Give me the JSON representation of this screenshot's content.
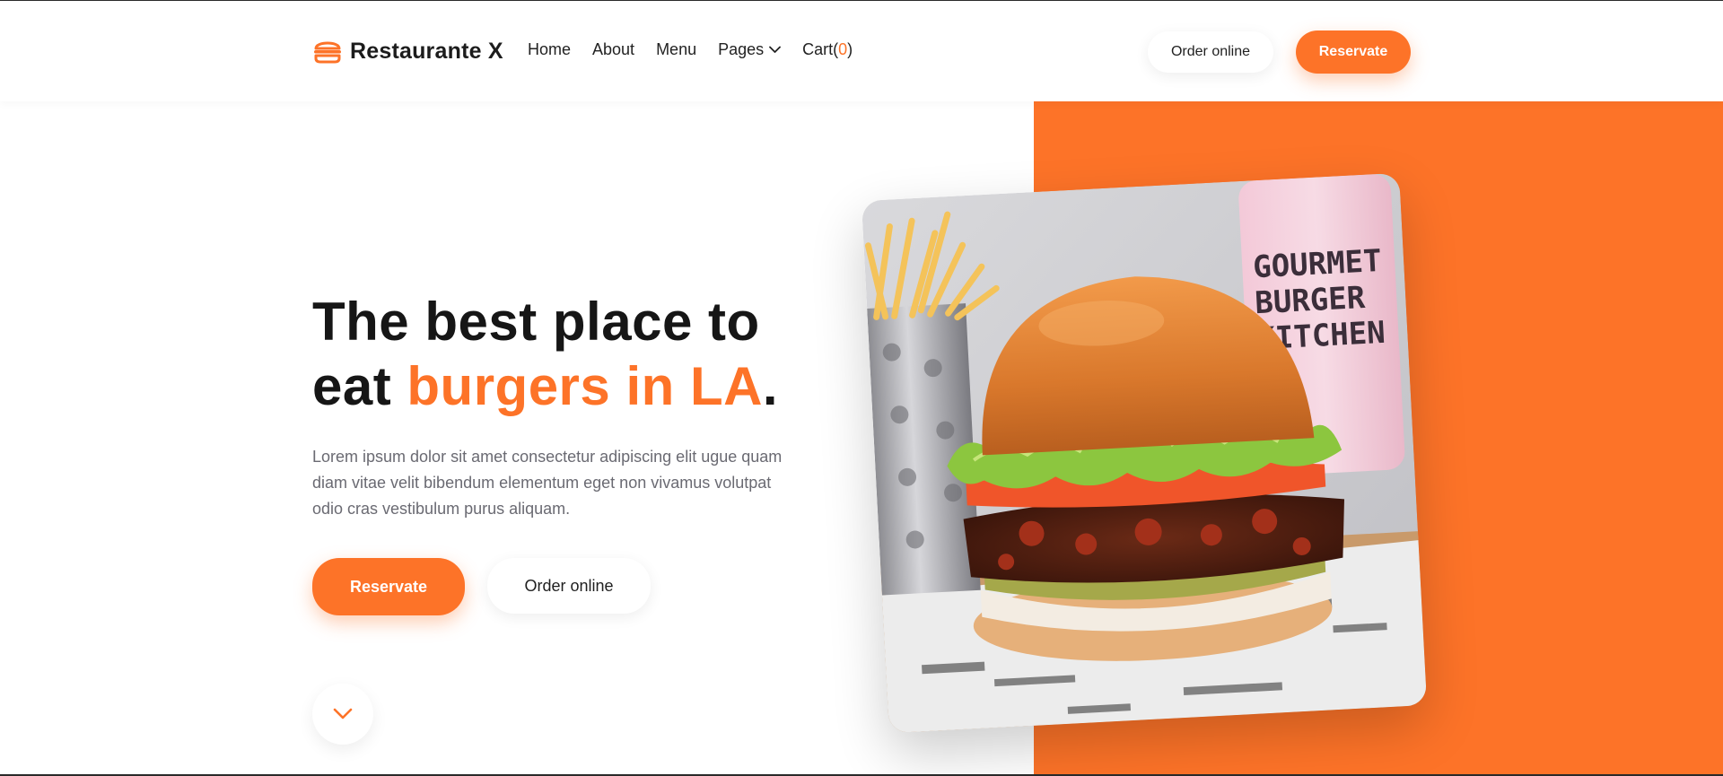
{
  "header": {
    "brand": "Restaurante X",
    "logo_icon": "burger-icon",
    "nav": {
      "home": "Home",
      "about": "About",
      "menu": "Menu",
      "pages": "Pages",
      "cart_label": "Cart(",
      "cart_count": "0",
      "cart_close": ")"
    },
    "order_online": "Order online",
    "reservate": "Reservate"
  },
  "hero": {
    "headline_part1": "The best place to",
    "headline_part2": "eat ",
    "headline_accent": "burgers in LA",
    "headline_end": ".",
    "description": "Lorem ipsum dolor sit amet consectetur adipiscing elit ugue quam diam vitae velit bibendum elementum eget non vivamus volutpat odio cras vestibulum purus aliquam.",
    "reservate": "Reservate",
    "order_online": "Order online",
    "scroll_icon": "chevron-down-icon"
  },
  "image": {
    "subject": "burger-photo",
    "cup_text_line1": "GOURMET",
    "cup_text_line2": "BURGER",
    "cup_text_line3": "KITCHEN"
  },
  "colors": {
    "accent": "#fd7328",
    "text": "#161616",
    "muted": "#6a6a72",
    "background": "#ffffff"
  }
}
